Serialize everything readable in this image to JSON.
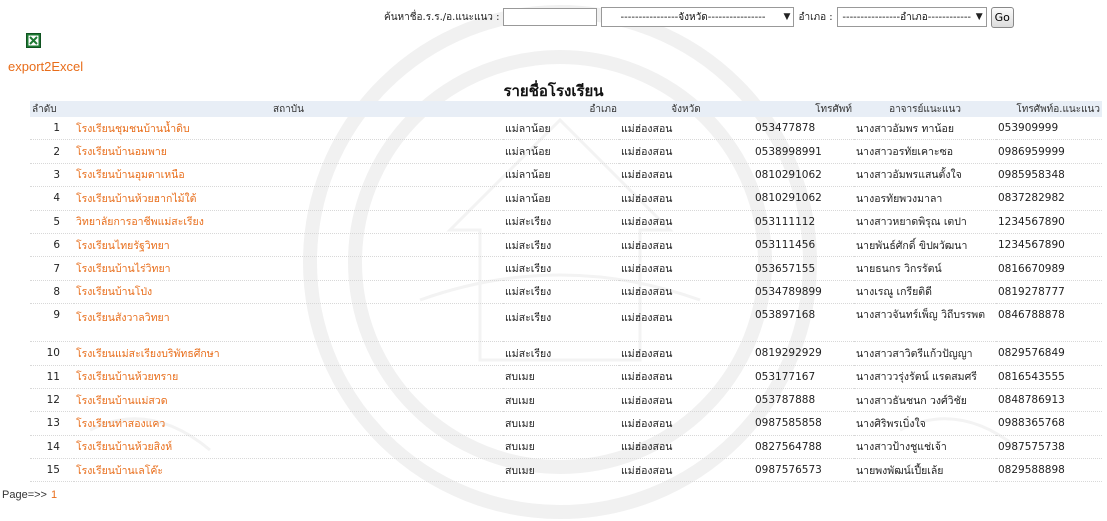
{
  "search": {
    "label_name": "ค้นหาชื่อ.ร.ร./อ.แนะแนว :",
    "name_value": "",
    "province_select": "----------------จังหวัด----------------",
    "label_district": "อำเภอ :",
    "district_select": "----------------อำเภอ------------",
    "go_label": "Go"
  },
  "export": {
    "icon": "excel-icon",
    "label": "export2Excel"
  },
  "title": "รายชื่อโรงเรียน",
  "table": {
    "headers": [
      "ลำดับ",
      "สถาบัน",
      "อำเภอ",
      "จังหวัด",
      "โทรศัพท์",
      "อาจารย์แนะแนว",
      "โทรศัพท์อ.แนะแนว"
    ],
    "rows": [
      [
        "1",
        "โรงเรียนชุมชนบ้านน้ำดิบ",
        "แม่ลาน้อย",
        "แม่ฮ่องสอน",
        "053477878",
        "นางสาวอัมพร ทาน้อย",
        "053909999"
      ],
      [
        "2",
        "โรงเรียนบ้านอมพาย",
        "แม่ลาน้อย",
        "แม่ฮ่องสอน",
        "0538998991",
        "นางสาวอรทัยเคาะซอ",
        "0986959999"
      ],
      [
        "3",
        "โรงเรียนบ้านอุมดาเหนือ",
        "แม่ลาน้อย",
        "แม่ฮ่องสอน",
        "0810291062",
        "นางสาวอัมพรแสนตั้งใจ",
        "0985958348"
      ],
      [
        "4",
        "โรงเรียนบ้านห้วยฮากไม้ใต้",
        "แม่ลาน้อย",
        "แม่ฮ่องสอน",
        "0810291062",
        "นางอรทัยพวงมาลา",
        "0837282982"
      ],
      [
        "5",
        "วิทยาลัยการอาชีพแม่สะเรียง",
        "แม่สะเรียง",
        "แม่ฮ่องสอน",
        "053111112",
        "นางสาวหยาดพิรุณ เตปา",
        "1234567890"
      ],
      [
        "6",
        "โรงเรียนไทยรัฐวิทยา",
        "แม่สะเรียง",
        "แม่ฮ่องสอน",
        "053111456",
        "นายพันธ์ศักดิ์ ขิปผวัฒนา",
        "1234567890"
      ],
      [
        "7",
        "โรงเรียนบ้านไร่วิทยา",
        "แม่สะเรียง",
        "แม่ฮ่องสอน",
        "053657155",
        "นายธนกร วิกรรัตน์",
        "0816670989"
      ],
      [
        "8",
        "โรงเรียนบ้านโป่ง",
        "แม่สะเรียง",
        "แม่ฮ่องสอน",
        "0534789899",
        "นางเรณู เกรียติดี",
        "0819278777"
      ],
      [
        "9",
        "โรงเรียนสังวาลวิทยา",
        "แม่สะเรียง",
        "แม่ฮ่องสอน",
        "053897168",
        "นางสาวจันทร์เพ็ญ วิถีบรรพต",
        "0846788878"
      ],
      [
        "10",
        "โรงเรียนแม่สะเรียงบริพัทธศึกษา",
        "แม่สะเรียง",
        "แม่ฮ่องสอน",
        "0819292929",
        "นางสาวสาวิตรีแก้วปัญญา",
        "0829576849"
      ],
      [
        "11",
        "โรงเรียนบ้านห้วยทราย",
        "สบเมย",
        "แม่ฮ่องสอน",
        "053177167",
        "นางสาววรุ่งรัตน์ แรดสมศรี",
        "0816543555"
      ],
      [
        "12",
        "โรงเรียนบ้านแม่สวด",
        "สบเมย",
        "แม่ฮ่องสอน",
        "053787888",
        "นางสาวธันชนก วงศ์วิชัย",
        "0848786913"
      ],
      [
        "13",
        "โรงเรียนท่าสองแคว",
        "สบเมย",
        "แม่ฮ่องสอน",
        "0987585858",
        "นางศิริพรเบิ่งใจ",
        "0988365768"
      ],
      [
        "14",
        "โรงเรียนบ้านห้วยสิงห์",
        "สบเมย",
        "แม่ฮ่องสอน",
        "0827564788",
        "นางสาวป้างชูแช่เจ้า",
        "0987575738"
      ],
      [
        "15",
        "โรงเรียนบ้านเลโค๊ะ",
        "สบเมย",
        "แม่ฮ่องสอน",
        "0987576573",
        "นายพงพัฒน์เปี้ยเล้ย",
        "0829588898"
      ]
    ]
  },
  "pager": {
    "label": "Page=>>",
    "current": "1"
  },
  "colors": {
    "link": "#e86d1a",
    "header_bg": "#e8eef6",
    "excel_green": "#1d7a33"
  }
}
